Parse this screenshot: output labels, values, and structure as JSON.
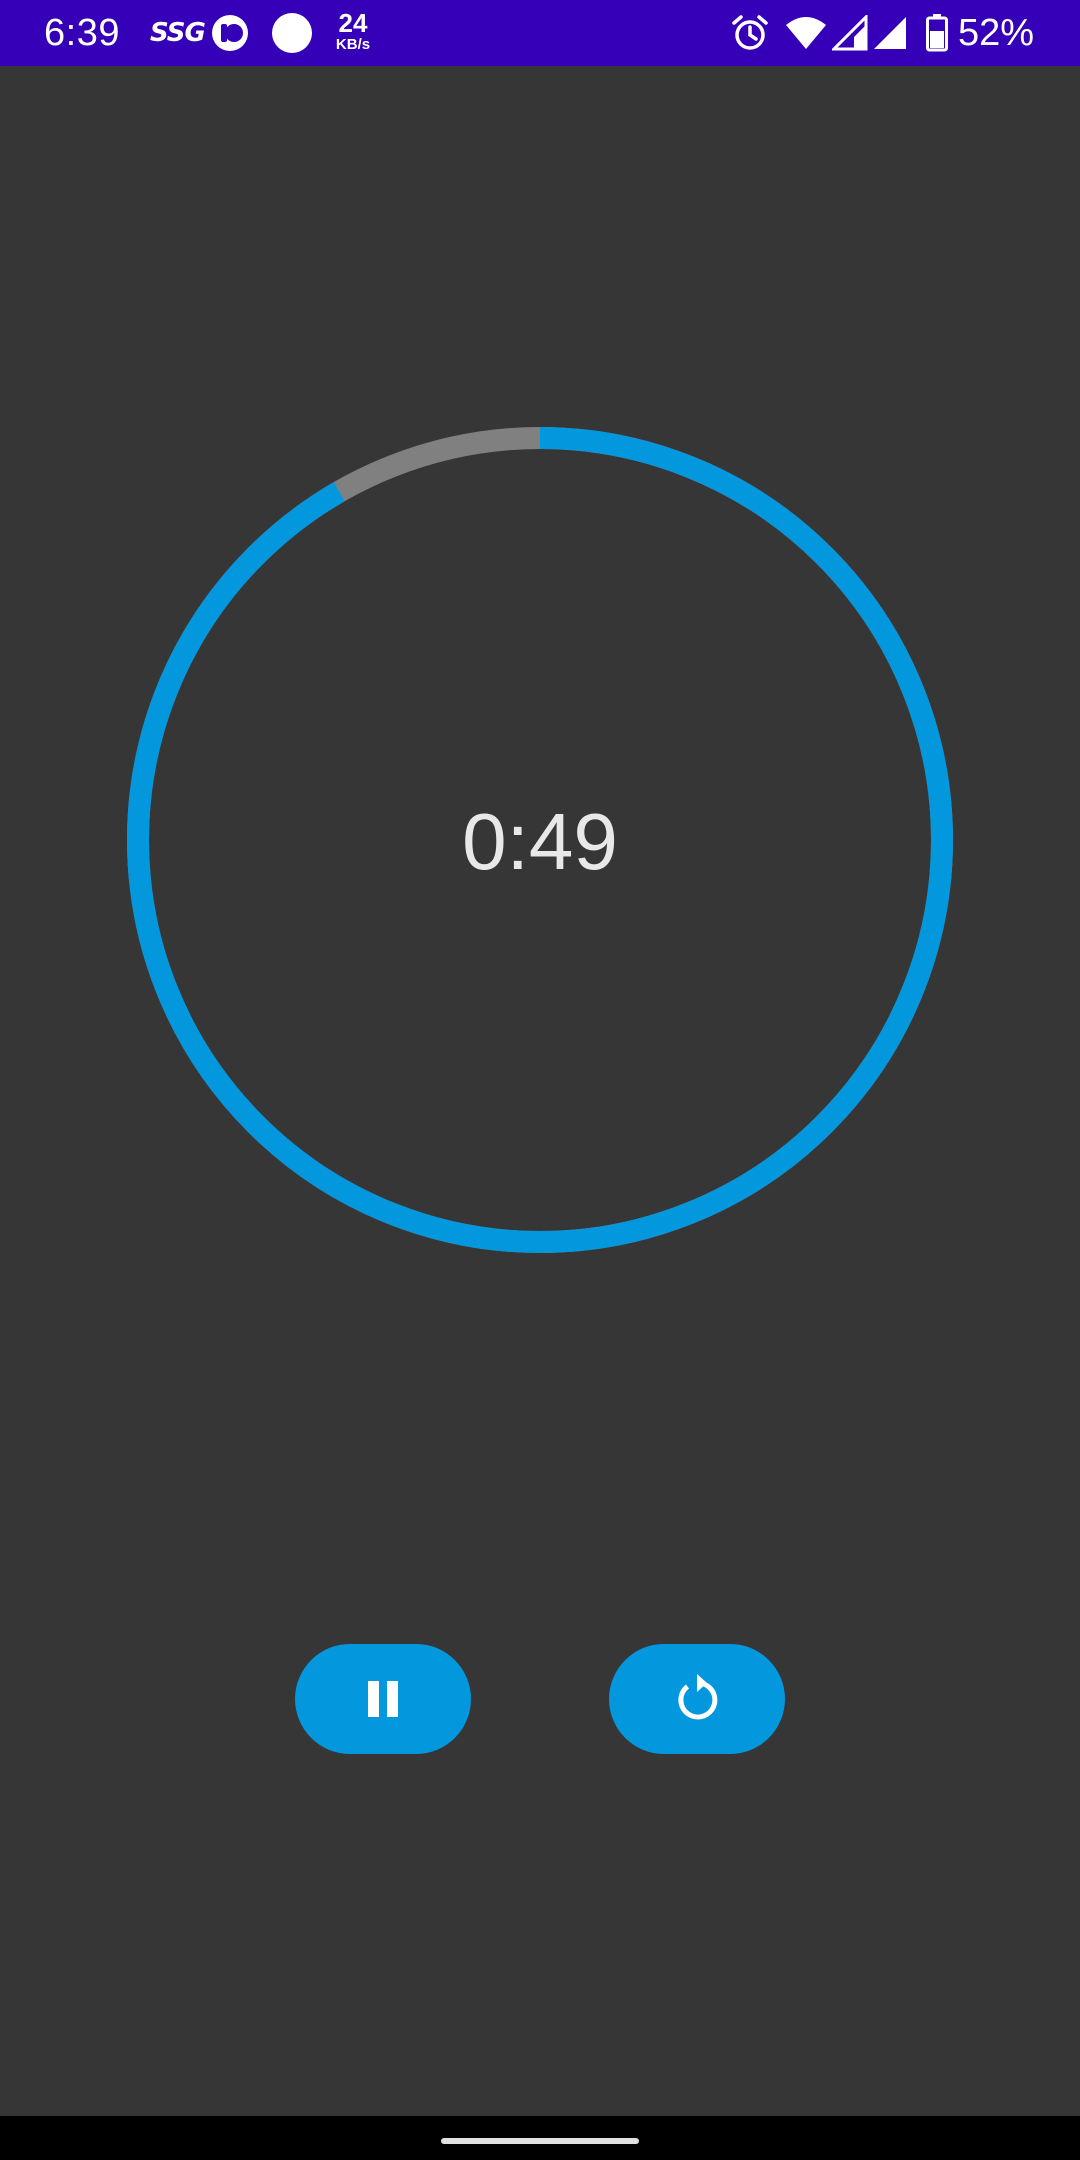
{
  "status_bar": {
    "time": "6:39",
    "carrier_badge": "SSG",
    "net_speed_value": "24",
    "net_speed_unit": "KB/s",
    "battery_percent": "52%",
    "icons": [
      "ssg-icon",
      "app-notification-icon",
      "circle-notification-icon",
      "alarm-icon",
      "wifi-icon",
      "signal-icon",
      "signal-icon",
      "battery-icon"
    ],
    "background_color": "#3600b8"
  },
  "timer": {
    "display": "0:49",
    "progress_fraction": 0.9167,
    "progress_color": "#0397de",
    "track_color": "#808080"
  },
  "controls": {
    "pause_icon": "pause-icon",
    "reset_icon": "reset-icon",
    "button_color": "#0397de"
  },
  "theme": {
    "background": "#363636"
  }
}
